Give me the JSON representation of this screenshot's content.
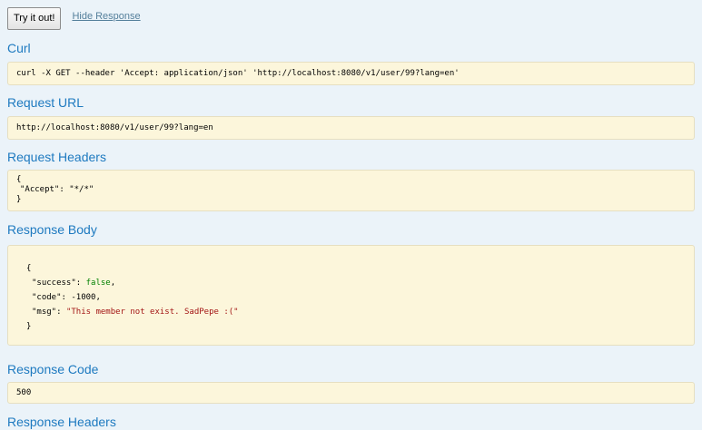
{
  "controls": {
    "try_label": "Try it out!",
    "hide_label": "Hide Response"
  },
  "curl": {
    "heading": "Curl",
    "command": "curl -X GET --header 'Accept: application/json' 'http://localhost:8080/v1/user/99?lang=en'"
  },
  "request_url": {
    "heading": "Request URL",
    "value": "http://localhost:8080/v1/user/99?lang=en"
  },
  "request_headers": {
    "heading": "Request Headers",
    "open": "{",
    "key": "\"Accept\"",
    "sep": ": ",
    "value": "\"*/*\"",
    "close": "}"
  },
  "response_body": {
    "heading": "Response Body",
    "open": "{",
    "lines": [
      {
        "key": "\"success\"",
        "sep": ": ",
        "value": "false",
        "end": ","
      },
      {
        "key": "\"code\"",
        "sep": ": ",
        "value": "-1000",
        "end": ","
      },
      {
        "key": "\"msg\"",
        "sep": ": ",
        "value": "\"This member not exist. SadPepe :(\"",
        "end": ""
      }
    ],
    "close": "}"
  },
  "response_code": {
    "heading": "Response Code",
    "value": "500"
  },
  "response_headers": {
    "heading": "Response Headers"
  },
  "colors": {
    "page_bg": "#ebf3f9",
    "heading": "#1e7ac0",
    "box_bg": "#fcf6db",
    "link": "#547f9b",
    "bool": "#008000",
    "string": "#a31515"
  }
}
